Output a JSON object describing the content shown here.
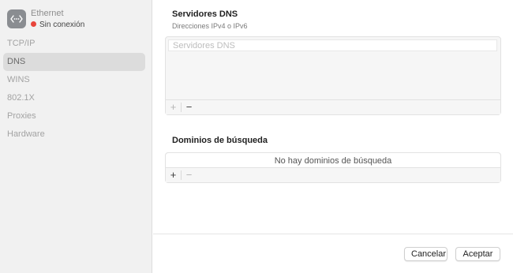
{
  "interface": {
    "name": "Ethernet",
    "status": "Sin conexión",
    "status_color": "#e8453c",
    "icon": "ethernet-icon"
  },
  "sidebar": {
    "items": [
      {
        "label": "TCP/IP",
        "active": false
      },
      {
        "label": "DNS",
        "active": true
      },
      {
        "label": "WINS",
        "active": false
      },
      {
        "label": "802.1X",
        "active": false
      },
      {
        "label": "Proxies",
        "active": false
      },
      {
        "label": "Hardware",
        "active": false
      }
    ]
  },
  "dns": {
    "title": "Servidores DNS",
    "subtitle": "Direcciones IPv4 o IPv6",
    "placeholder": "Servidores DNS",
    "add": "+",
    "remove": "−"
  },
  "search_domains": {
    "title": "Dominios de búsqueda",
    "empty": "No hay dominios de búsqueda",
    "add": "+",
    "remove": "−"
  },
  "footer": {
    "cancel": "Cancelar",
    "ok": "Aceptar"
  }
}
